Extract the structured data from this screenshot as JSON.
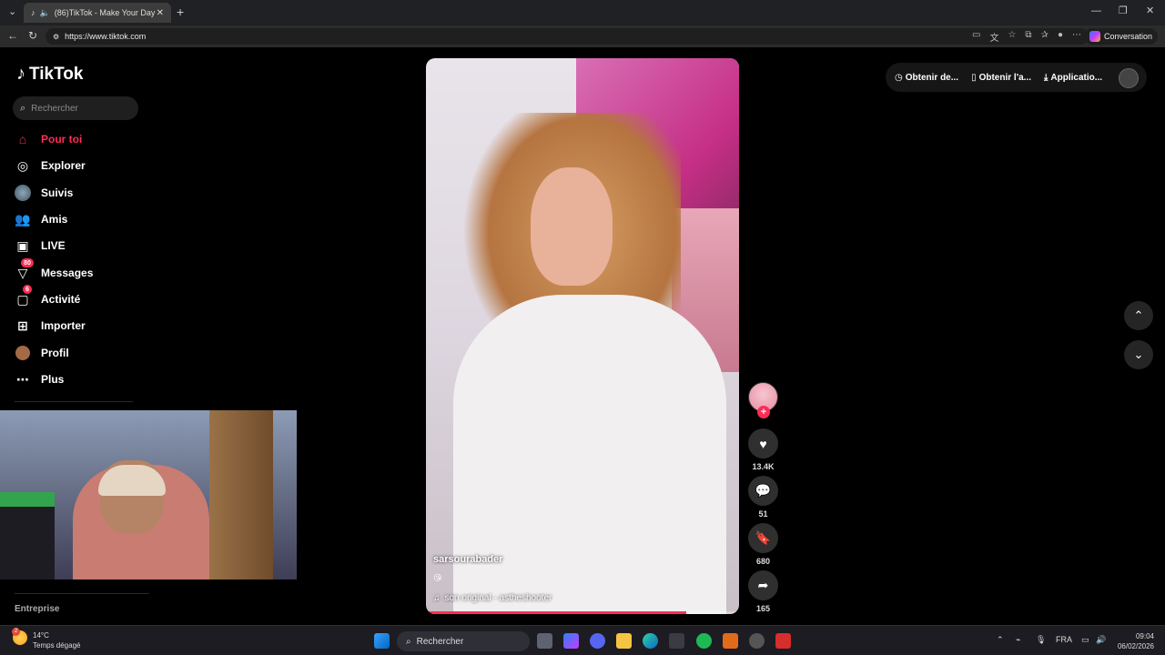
{
  "browser": {
    "tab_title": "(86)TikTok - Make Your Day",
    "url": "https://www.tiktok.com",
    "conversation_label": "Conversation"
  },
  "sidebar": {
    "brand": "TikTok",
    "search_placeholder": "Rechercher",
    "items": [
      {
        "label": "Pour toi",
        "icon": "home-icon",
        "active": true
      },
      {
        "label": "Explorer",
        "icon": "compass-icon"
      },
      {
        "label": "Suivis",
        "icon": "following-avatar-icon"
      },
      {
        "label": "Amis",
        "icon": "friends-icon"
      },
      {
        "label": "LIVE",
        "icon": "live-tv-icon"
      },
      {
        "label": "Messages",
        "icon": "messages-icon",
        "badge": "80"
      },
      {
        "label": "Activité",
        "icon": "activity-icon",
        "badge": "6"
      },
      {
        "label": "Importer",
        "icon": "upload-icon"
      },
      {
        "label": "Profil",
        "icon": "profile-avatar-icon"
      },
      {
        "label": "Plus",
        "icon": "more-icon"
      }
    ],
    "footer": "Entreprise"
  },
  "top_actions": {
    "items": [
      "Obtenir de...",
      "Obtenir l'a...",
      "Applicatio..."
    ]
  },
  "video": {
    "username": "sarsourabader",
    "emoji": "😘",
    "sound": "son original - astheshooter",
    "progress": 0.83
  },
  "actions": {
    "likes": "13.4K",
    "comments": "51",
    "saves": "680",
    "shares": "165"
  },
  "taskbar": {
    "temperature": "14°C",
    "weather": "Temps dégagé",
    "weather_badge": "2",
    "search_placeholder": "Rechercher",
    "language": "FRA",
    "time": "09:04",
    "date": "06/02/2026"
  },
  "colors": {
    "accent": "#fe2c55",
    "background": "#000000"
  }
}
